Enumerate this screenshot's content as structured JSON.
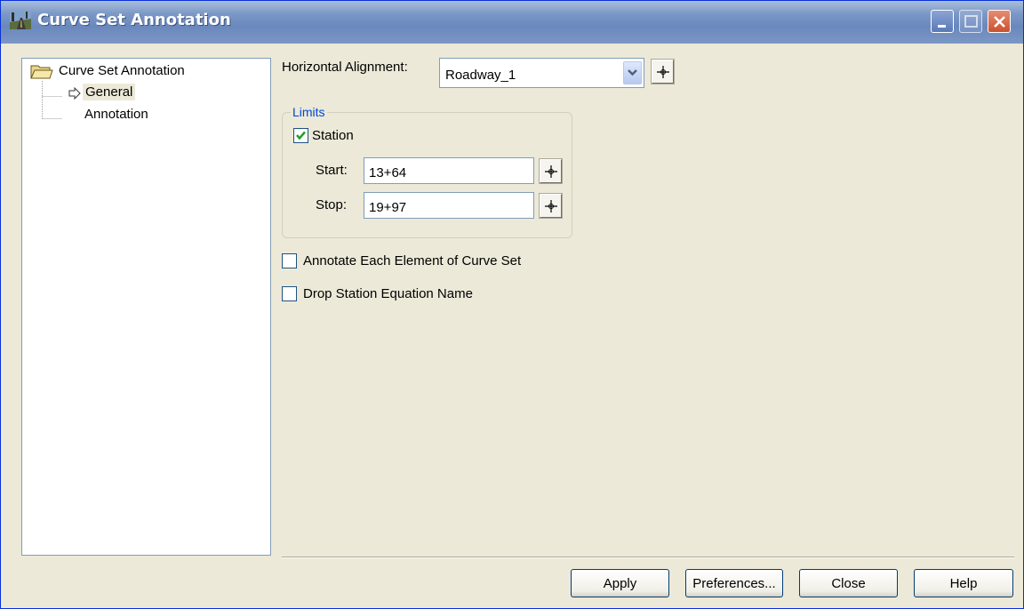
{
  "window": {
    "title": "Curve Set Annotation",
    "controls": {
      "minimize": "minimize-icon",
      "maximize": "maximize-icon",
      "close": "close-icon"
    }
  },
  "tree": {
    "root": {
      "label": "Curve Set Annotation",
      "icon": "folder-open-icon"
    },
    "items": [
      {
        "label": "General",
        "selected": true,
        "icon": "arrow-right-icon"
      },
      {
        "label": "Annotation",
        "selected": false
      }
    ]
  },
  "form": {
    "alignment_label": "Horizontal Alignment:",
    "alignment_value": "Roadway_1",
    "limits": {
      "legend": "Limits",
      "station_label": "Station",
      "station_checked": true,
      "start_label": "Start:",
      "start_value": "13+64",
      "stop_label": "Stop:",
      "stop_value": "19+97"
    },
    "annotate_each_label": "Annotate Each Element of Curve Set",
    "annotate_each_checked": false,
    "drop_equation_label": "Drop Station Equation Name",
    "drop_equation_checked": false
  },
  "buttons": {
    "apply": "Apply",
    "preferences": "Preferences...",
    "close": "Close",
    "help": "Help"
  },
  "colors": {
    "accent": "#0046d5",
    "title_bar": "#7b98c6",
    "dialog_bg": "#ece9d8"
  }
}
